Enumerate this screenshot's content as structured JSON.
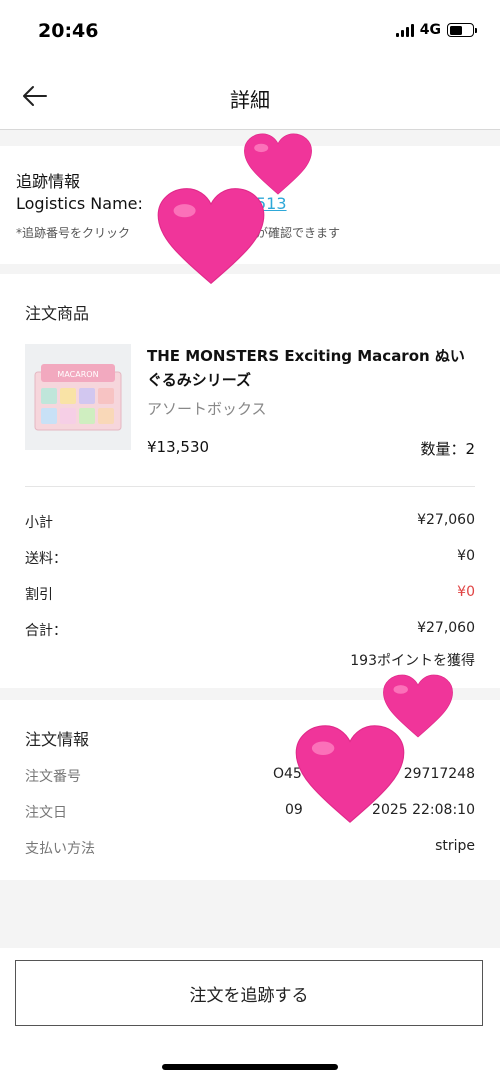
{
  "status_bar": {
    "time": "20:46",
    "network": "4G"
  },
  "nav": {
    "title": "詳細"
  },
  "tracking": {
    "title": "追跡情報",
    "logistics_label": "Logistics Name:",
    "tracking_number_visible": "513",
    "note": "*追跡番号をクリック",
    "note_tail": "送状況が確認できます"
  },
  "products": {
    "section_title": "注文商品",
    "item": {
      "name": "THE MONSTERS Exciting Macaron ぬいぐるみシリーズ",
      "variant": "アソートボックス",
      "price": "¥13,530",
      "quantity": "数量：2"
    },
    "summary": [
      {
        "label": "小計",
        "value": "¥27,060"
      },
      {
        "label": "送料：",
        "value": "¥0"
      },
      {
        "label": "割引",
        "value": "¥0"
      },
      {
        "label": "合計：",
        "value": "¥27,060"
      }
    ],
    "points": "193ポイントを獲得"
  },
  "order_info": {
    "section_title": "注文情報",
    "rows": [
      {
        "label": "注文番号",
        "value_left": "O45",
        "value_right": "29717248"
      },
      {
        "label": "注文日",
        "value_left": "09",
        "value_right": "2025 22:08:10"
      },
      {
        "label": "支払い方法",
        "value": "stripe"
      }
    ]
  },
  "actions": {
    "track_order": "注文を追跡する"
  },
  "colors": {
    "link": "#2ea8d8",
    "discount": "#e04444",
    "heart": "#f0359a"
  },
  "icons": [
    "back-arrow-icon",
    "signal-icon",
    "battery-icon",
    "heart-sticker-icon"
  ]
}
